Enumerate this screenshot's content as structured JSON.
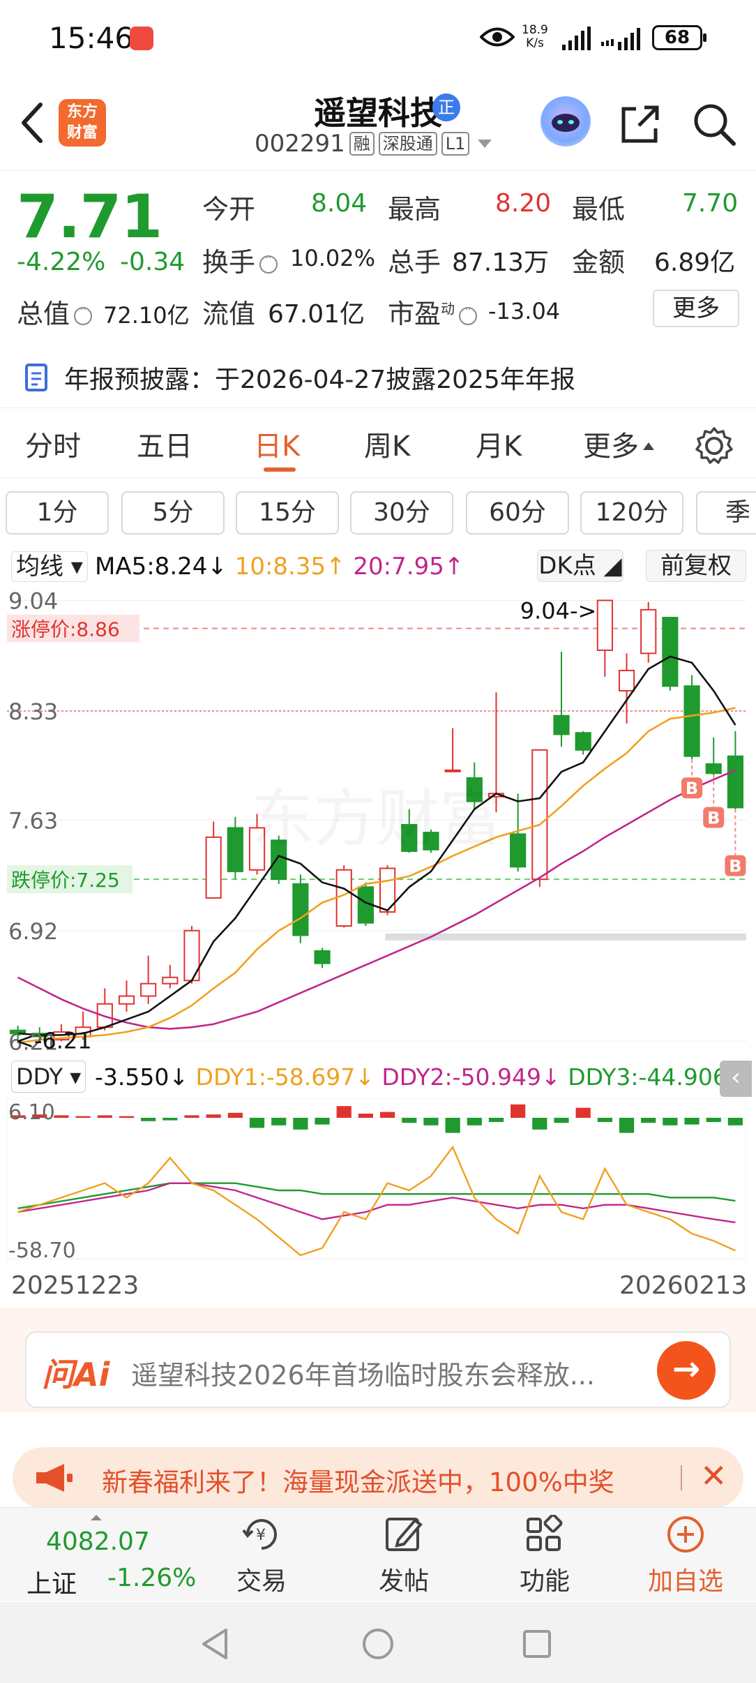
{
  "status_bar": {
    "time": "15:46",
    "net_speed_value": "18.9",
    "net_speed_unit": "K/s",
    "battery": "68"
  },
  "header": {
    "logo_line1": "东方",
    "logo_line2": "财富",
    "stock_name": "遥望科技",
    "badge": "正",
    "code": "002291",
    "tags": [
      "融",
      "深股通",
      "L1"
    ]
  },
  "quote": {
    "price": "7.71",
    "change_pct": "-4.22%",
    "change": "-0.34",
    "open_label": "今开",
    "open": "8.04",
    "high_label": "最高",
    "high": "8.20",
    "low_label": "最低",
    "low": "7.70",
    "turnover_label": "换手",
    "turnover": "10.02%",
    "volume_label": "总手",
    "volume": "87.13万",
    "amount_label": "金额",
    "amount": "6.89亿",
    "mktcap_label": "总值",
    "mktcap": "72.10亿",
    "float_label": "流值",
    "float": "67.01亿",
    "pe_label": "市盈",
    "pe_sup": "动",
    "pe": "-13.04",
    "more": "更多"
  },
  "notice": {
    "text": "年报预披露：于2026-04-27披露2025年年报"
  },
  "tabs": {
    "items": [
      "分时",
      "五日",
      "日K",
      "周K",
      "月K",
      "更多"
    ],
    "active": "日K"
  },
  "minute_buttons": [
    "1分",
    "5分",
    "15分",
    "30分",
    "60分",
    "120分",
    "季"
  ],
  "legend": {
    "ma_select": "均线",
    "ma5": "MA5:8.24↓",
    "ma10": "10:8.35↑",
    "ma20": "20:7.95↑",
    "dk": "DK点",
    "adjust": "前复权"
  },
  "colors": {
    "up": "#e0332f",
    "down": "#1f9a2e",
    "ma5": "#111111",
    "ma10": "#f0a020",
    "ma20": "#c0268a",
    "accent": "#e3612f"
  },
  "chart_data": {
    "type": "candlestick",
    "y_ticks": [
      "9.04",
      "8.33",
      "7.63",
      "6.92",
      "6.21"
    ],
    "limit_up_label": "涨停价:8.86",
    "limit_down_label": "跌停价:7.25",
    "high_annotation": "9.04->",
    "low_annotation": "<-6.21",
    "ylim": [
      6.18,
      9.06
    ],
    "candles": [
      {
        "o": 6.28,
        "c": 6.26,
        "h": 6.31,
        "l": 6.2
      },
      {
        "o": 6.26,
        "c": 6.24,
        "h": 6.3,
        "l": 6.21
      },
      {
        "o": 6.22,
        "c": 6.27,
        "h": 6.32,
        "l": 6.21
      },
      {
        "o": 6.24,
        "c": 6.3,
        "h": 6.4,
        "l": 6.22
      },
      {
        "o": 6.3,
        "c": 6.45,
        "h": 6.55,
        "l": 6.28
      },
      {
        "o": 6.45,
        "c": 6.5,
        "h": 6.6,
        "l": 6.4
      },
      {
        "o": 6.5,
        "c": 6.58,
        "h": 6.76,
        "l": 6.45
      },
      {
        "o": 6.58,
        "c": 6.62,
        "h": 6.7,
        "l": 6.55
      },
      {
        "o": 6.6,
        "c": 6.92,
        "h": 6.95,
        "l": 6.58
      },
      {
        "o": 7.13,
        "c": 7.52,
        "h": 7.62,
        "l": 7.13
      },
      {
        "o": 7.58,
        "c": 7.3,
        "h": 7.65,
        "l": 7.25
      },
      {
        "o": 7.31,
        "c": 7.58,
        "h": 7.67,
        "l": 7.28
      },
      {
        "o": 7.5,
        "c": 7.25,
        "h": 7.53,
        "l": 7.22
      },
      {
        "o": 7.22,
        "c": 6.89,
        "h": 7.28,
        "l": 6.84
      },
      {
        "o": 6.79,
        "c": 6.71,
        "h": 6.81,
        "l": 6.68
      },
      {
        "o": 6.95,
        "c": 7.31,
        "h": 7.34,
        "l": 6.94
      },
      {
        "o": 7.2,
        "c": 6.97,
        "h": 7.23,
        "l": 6.95
      },
      {
        "o": 7.04,
        "c": 7.32,
        "h": 7.34,
        "l": 7.02
      },
      {
        "o": 7.6,
        "c": 7.43,
        "h": 7.7,
        "l": 7.42
      },
      {
        "o": 7.55,
        "c": 7.44,
        "h": 7.57,
        "l": 7.42
      },
      {
        "o": 7.95,
        "c": 7.95,
        "h": 8.22,
        "l": 7.95
      },
      {
        "o": 7.9,
        "c": 7.75,
        "h": 8.0,
        "l": 7.7
      },
      {
        "o": 7.78,
        "c": 7.8,
        "h": 8.45,
        "l": 7.68
      },
      {
        "o": 7.54,
        "c": 7.33,
        "h": 7.8,
        "l": 7.3
      },
      {
        "o": 7.25,
        "c": 8.08,
        "h": 8.07,
        "l": 7.2
      },
      {
        "o": 8.3,
        "c": 8.18,
        "h": 8.71,
        "l": 8.1
      },
      {
        "o": 8.19,
        "c": 8.08,
        "h": 8.2,
        "l": 8.05
      },
      {
        "o": 8.72,
        "c": 9.04,
        "h": 9.04,
        "l": 8.55
      },
      {
        "o": 8.46,
        "c": 8.59,
        "h": 8.7,
        "l": 8.25
      },
      {
        "o": 8.7,
        "c": 8.98,
        "h": 9.03,
        "l": 8.64
      },
      {
        "o": 8.93,
        "c": 8.49,
        "h": 8.93,
        "l": 8.46
      },
      {
        "o": 8.49,
        "c": 8.04,
        "h": 8.56,
        "l": 8.02
      },
      {
        "o": 7.99,
        "c": 7.93,
        "h": 8.16,
        "l": 7.92
      },
      {
        "o": 8.04,
        "c": 7.71,
        "h": 8.2,
        "l": 7.7
      }
    ],
    "ma5": [
      6.26,
      6.25,
      6.25,
      6.26,
      6.3,
      6.35,
      6.4,
      6.5,
      6.6,
      6.85,
      7.0,
      7.2,
      7.4,
      7.35,
      7.23,
      7.19,
      7.1,
      7.05,
      7.2,
      7.3,
      7.5,
      7.7,
      7.8,
      7.75,
      7.77,
      7.94,
      8.0,
      8.2,
      8.4,
      8.6,
      8.68,
      8.64,
      8.46,
      8.24
    ],
    "ma10": [
      6.2,
      6.22,
      6.23,
      6.24,
      6.25,
      6.27,
      6.3,
      6.36,
      6.44,
      6.55,
      6.65,
      6.8,
      6.92,
      7.0,
      7.1,
      7.15,
      7.22,
      7.24,
      7.27,
      7.33,
      7.4,
      7.46,
      7.52,
      7.56,
      7.6,
      7.72,
      7.85,
      7.96,
      8.06,
      8.2,
      8.28,
      8.3,
      8.32,
      8.35
    ],
    "ma20": [
      6.62,
      6.55,
      6.48,
      6.42,
      6.37,
      6.33,
      6.3,
      6.29,
      6.3,
      6.32,
      6.36,
      6.4,
      6.46,
      6.52,
      6.58,
      6.64,
      6.7,
      6.76,
      6.82,
      6.88,
      6.95,
      7.02,
      7.1,
      7.18,
      7.26,
      7.35,
      7.43,
      7.52,
      7.6,
      7.68,
      7.76,
      7.83,
      7.89,
      7.95
    ],
    "b_markers": [
      31,
      32,
      33
    ],
    "x_labels": [
      "20251223",
      "20260213"
    ]
  },
  "ddy": {
    "select": "DDY",
    "main": "-3.550↓",
    "ddy1": "DDY1:-58.697↓",
    "ddy2": "DDY2:-50.949↓",
    "ddy3": "DDY3:-44.906↓",
    "y_top": "6.10",
    "y_bottom": "-58.70",
    "bars": [
      0.3,
      0.4,
      0.3,
      0.2,
      0.3,
      0.2,
      -0.4,
      -0.3,
      0.3,
      0.4,
      0.6,
      -1.2,
      -0.9,
      -1.4,
      -0.8,
      1.4,
      0.5,
      0.7,
      -0.6,
      -0.9,
      -1.8,
      -0.9,
      -0.5,
      1.6,
      -1.4,
      -0.6,
      1.2,
      -0.5,
      -1.8,
      -0.6,
      -0.9,
      -0.8,
      -0.5,
      -0.9
    ],
    "ddy1_line": [
      -48,
      -46,
      -44,
      -42,
      -40,
      -44,
      -40,
      -33,
      -40,
      -42,
      -46,
      -50,
      -55,
      -60,
      -58,
      -48,
      -50,
      -40,
      -42,
      -38,
      -30,
      -44,
      -50,
      -54,
      -38,
      -48,
      -50,
      -36,
      -46,
      -48,
      -50,
      -54,
      -56,
      -58.7
    ],
    "ddy2_line": [
      -48,
      -47,
      -46,
      -45,
      -44,
      -43,
      -42,
      -40,
      -40,
      -41,
      -42,
      -44,
      -46,
      -48,
      -50,
      -49,
      -48,
      -46,
      -46,
      -45,
      -44,
      -45,
      -46,
      -47,
      -46,
      -46,
      -47,
      -46,
      -46,
      -47,
      -48,
      -49,
      -50,
      -50.9
    ],
    "ddy3_line": [
      -47,
      -46,
      -45,
      -44,
      -43,
      -42,
      -41,
      -40,
      -40,
      -40,
      -40,
      -41,
      -42,
      -42,
      -43,
      -43,
      -43,
      -43,
      -43,
      -43,
      -43,
      -43,
      -43,
      -43,
      -43,
      -43,
      -43,
      -43,
      -43,
      -43,
      -44,
      -44,
      -44,
      -44.9
    ]
  },
  "ai": {
    "logo": "问Ai",
    "text": "遥望科技2026年首场临时股东会释放..."
  },
  "promo": {
    "text": "新春福利来了！海量现金派送中，100%中奖"
  },
  "bottom_nav": {
    "index_value": "4082.07",
    "index_name": "上证",
    "index_pct": "-1.26%",
    "items": [
      "交易",
      "发帖",
      "功能",
      "加自选"
    ]
  }
}
